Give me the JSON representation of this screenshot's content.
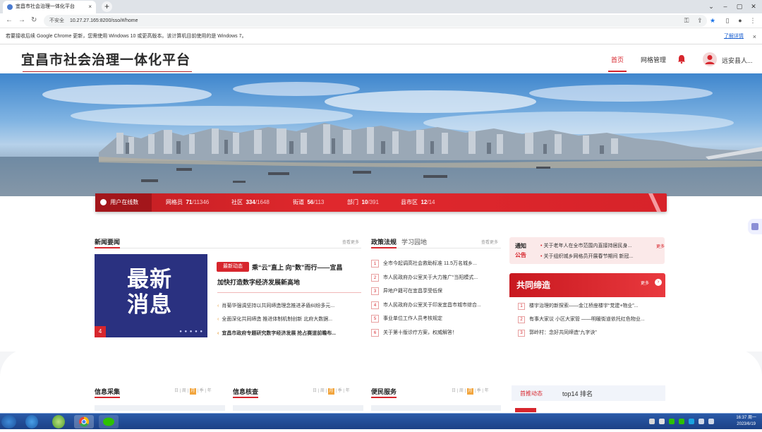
{
  "browser": {
    "tab_title": "宜昌市社会治理一体化平台",
    "tab_close": "×",
    "new_tab": "+",
    "security_label": "不安全",
    "url": "10.27.27.165:8200/sso/#/home",
    "info_message": "若要接收后续 Google Chrome 更新，您需使用 Windows 10 或更高版本。该计算机目前使用的是 Windows 7。",
    "info_link": "了解详情",
    "info_close": "×"
  },
  "header": {
    "site_title": "宜昌市社会治理一体化平台",
    "nav": [
      {
        "label": "首页"
      },
      {
        "label": "网格管理"
      }
    ],
    "username": "远安县人..."
  },
  "stats": {
    "online_label": "用户在线数",
    "items": [
      {
        "label": "网格员",
        "value": "71",
        "total": "/11346"
      },
      {
        "label": "社区",
        "value": "334",
        "total": "/1648"
      },
      {
        "label": "街道",
        "value": "56",
        "total": "/113"
      },
      {
        "label": "部门",
        "value": "10",
        "total": "/391"
      },
      {
        "label": "县市区",
        "value": "12",
        "total": "/14"
      }
    ]
  },
  "news": {
    "title": "新闻要闻",
    "more": "查看更多",
    "image_text_1": "最新",
    "image_text_2": "消息",
    "slide_index": "4",
    "dots": "● ● ● ● ●",
    "badge": "最新动态",
    "headline_1": "乘“云”直上 向“数”而行——宜昌",
    "headline_2": "加快打造数字经济发展新高地",
    "items": [
      "肖菊华强调坚持以共同缔造理念推进矛盾纠纷多元...",
      "全面深化共同缔造 推进体制机制创新 北府大数据...",
      "宜昌市政府专题研究数字经济发展 抢占赛道前瞻布..."
    ]
  },
  "laws": {
    "tab_active": "政策法规",
    "tab_other": "学习园地",
    "more": "查看更多",
    "items": [
      {
        "n": "1",
        "text": "全市今起调高社会救助标准 11.5万名城乡..."
      },
      {
        "n": "2",
        "text": "市人民政府办公室关于大力推广“当阳模式..."
      },
      {
        "n": "3",
        "text": "异地户籍可在宜昌享受低保"
      },
      {
        "n": "4",
        "text": "市人民政府办公室关于印发宜昌市城市综合..."
      },
      {
        "n": "5",
        "text": "事业单位工作人员考核规定"
      },
      {
        "n": "6",
        "text": "关于第十版诊疗方案，权威解答！"
      }
    ]
  },
  "notice": {
    "label_1": "通知",
    "label_2": "公告",
    "more": "更多",
    "items": [
      "关于老年人在全市范围内直接持居民身...",
      "关于组织城乡网格员开展春节期间 新冠..."
    ]
  },
  "gov": {
    "title": "共同缔造",
    "more": "更多",
    "items": [
      {
        "n": "1",
        "text": "楼宇治理的新探索——金江桥座楼宇“党建+物业”..."
      },
      {
        "n": "2",
        "text": "有事大家议 小区大家管 ——明暖街道依托红色物业..."
      },
      {
        "n": "3",
        "text": "郭岭村：念好共同缔造“九字诀”"
      }
    ]
  },
  "lower": {
    "sections": [
      {
        "title": "信息采集",
        "tabs": [
          "日",
          "周",
          "月",
          "季",
          "年"
        ]
      },
      {
        "title": "信息核查",
        "tabs": [
          "日",
          "周",
          "月",
          "季",
          "年"
        ]
      },
      {
        "title": "便民服务",
        "tabs": [
          "日",
          "周",
          "月",
          "季",
          "年"
        ]
      }
    ],
    "hot_label": "首推动态",
    "hot_rank": "top14 排名"
  },
  "taskbar": {
    "time": "16:37 周一",
    "date": "2023/6/19"
  }
}
